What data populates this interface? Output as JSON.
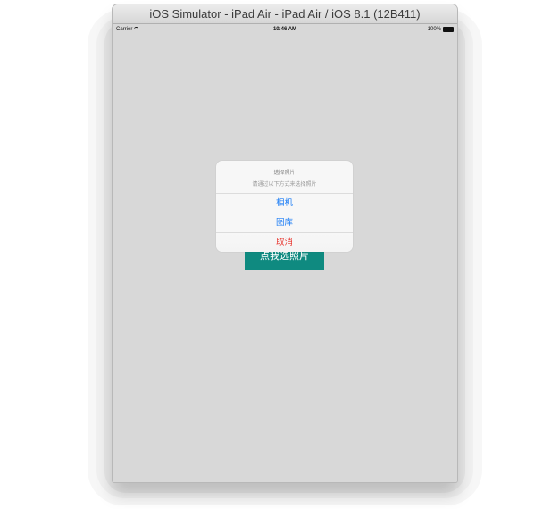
{
  "window": {
    "title": "iOS Simulator - iPad Air - iPad Air / iOS 8.1 (12B411)"
  },
  "status_bar": {
    "carrier": "Carrier",
    "time": "10:46 AM",
    "battery": "100%"
  },
  "screen": {
    "button_label": "点我选照片"
  },
  "action_sheet": {
    "title": "选择照片",
    "message": "请通过以下方式来选择照片",
    "actions": [
      {
        "label": "相机",
        "color": "#1b7cf5"
      },
      {
        "label": "图库",
        "color": "#1b7cf5"
      },
      {
        "label": "取消",
        "color": "#e8352e"
      }
    ]
  },
  "colors": {
    "button_bg": "#0f8a80",
    "screen_bg": "#d8d8d8"
  }
}
